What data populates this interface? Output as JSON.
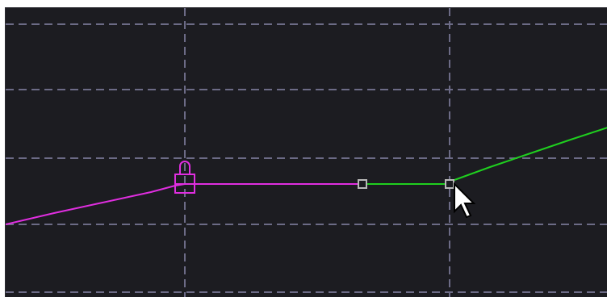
{
  "graph_editor": {
    "colors": {
      "background": "#1c1c21",
      "grid": "#6c6b86",
      "curve_locked": "#e02ee0",
      "curve_active": "#1fcf1f",
      "keyframe_outline": "#b9b9b9",
      "cursor_fill": "#ffffff",
      "cursor_outline": "#000000"
    },
    "grid": {
      "dashed": true
    },
    "curves": [
      {
        "name": "locked-curve",
        "color": "#e02ee0",
        "locked": true
      },
      {
        "name": "active-curve",
        "color": "#1fcf1f",
        "locked": false
      }
    ],
    "icons": {
      "lock": "padlock-icon",
      "cursor": "mouse-pointer-icon",
      "keyframe": "square-keyframe-handle"
    }
  }
}
